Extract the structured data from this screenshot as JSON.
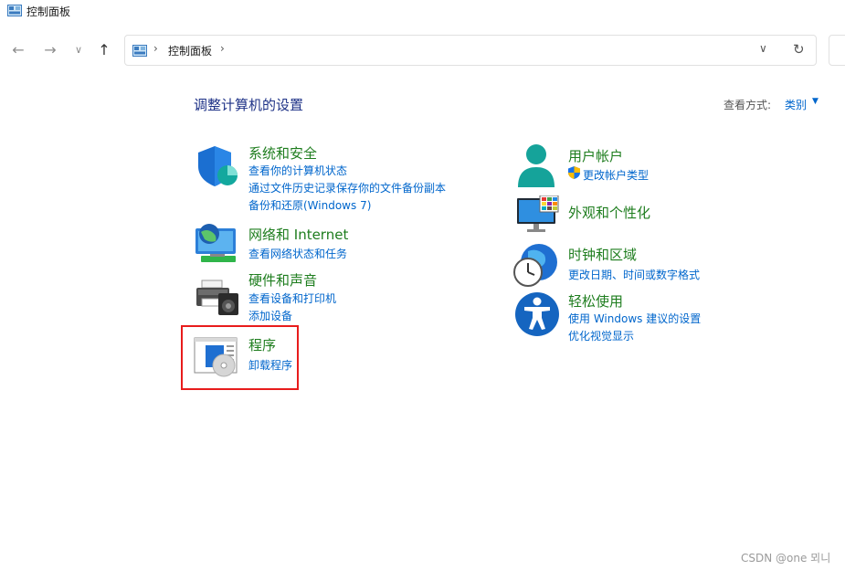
{
  "window": {
    "title": "控制面板"
  },
  "address": {
    "path": "控制面板"
  },
  "content": {
    "heading": "调整计算机的设置",
    "view_by": {
      "label": "查看方式:",
      "value": "类别"
    },
    "left": [
      {
        "title": "系统和安全",
        "links": [
          "查看你的计算机状态",
          "通过文件历史记录保存你的文件备份副本",
          "备份和还原(Windows 7)"
        ]
      },
      {
        "title": "网络和 Internet",
        "links": [
          "查看网络状态和任务"
        ]
      },
      {
        "title": "硬件和声音",
        "links": [
          "查看设备和打印机",
          "添加设备"
        ]
      },
      {
        "title": "程序",
        "links": [
          "卸载程序"
        ]
      }
    ],
    "right": [
      {
        "title": "用户帐户",
        "links": [
          "更改帐户类型"
        ]
      },
      {
        "title": "外观和个性化",
        "links": []
      },
      {
        "title": "时钟和区域",
        "links": [
          "更改日期、时间或数字格式"
        ]
      },
      {
        "title": "轻松使用",
        "links": [
          "使用 Windows 建议的设置",
          "优化视觉显示"
        ]
      }
    ]
  },
  "watermark": "CSDN @one 뫼니",
  "colors": {
    "category_title": "#1e7d1e",
    "link": "#0066cc",
    "heading": "#1e3287",
    "highlight": "#e81c1c"
  }
}
